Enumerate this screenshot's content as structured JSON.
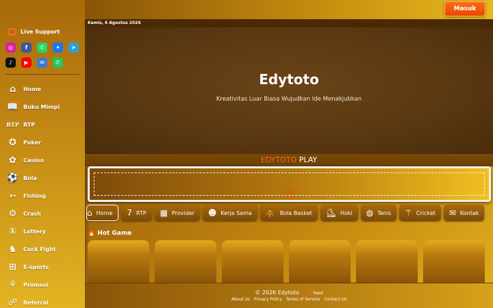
{
  "sidebar": {
    "live_support": "Live Support",
    "social_row1": [
      {
        "name": "instagram-icon",
        "glyph": "◎",
        "color": "#d6249f"
      },
      {
        "name": "facebook-icon",
        "glyph": "f",
        "color": "#3b5998"
      },
      {
        "name": "whatsapp-icon",
        "glyph": "✆",
        "color": "#25d366"
      },
      {
        "name": "messenger-icon",
        "glyph": "✦",
        "color": "#1877f2"
      },
      {
        "name": "telegram-icon",
        "glyph": "➤",
        "color": "#2aa1d8"
      }
    ],
    "social_row2": [
      {
        "name": "tiktok-icon",
        "glyph": "♪",
        "color": "#111111"
      },
      {
        "name": "youtube-icon",
        "glyph": "▶",
        "color": "#ff0000"
      },
      {
        "name": "email-icon",
        "glyph": "✉",
        "color": "#3a7bd5"
      },
      {
        "name": "phone-icon",
        "glyph": "✆",
        "color": "#22c55e"
      }
    ],
    "items": [
      {
        "label": "Home",
        "icon": "home-icon",
        "glyph": "⌂"
      },
      {
        "label": "Buku Mimpi",
        "icon": "book-icon",
        "glyph": "📖"
      },
      {
        "label": "RTP",
        "icon": "rtp-icon",
        "glyph": "RTP"
      },
      {
        "label": "Poker",
        "icon": "poker-chip-icon",
        "glyph": "✪"
      },
      {
        "label": "Casino",
        "icon": "casino-icon",
        "glyph": "✿"
      },
      {
        "label": "Bola",
        "icon": "soccer-shoe-icon",
        "glyph": "⚽"
      },
      {
        "label": "Fishing",
        "icon": "fish-icon",
        "glyph": "➳"
      },
      {
        "label": "Crash",
        "icon": "crash-icon",
        "glyph": "⚙"
      },
      {
        "label": "Lottery",
        "icon": "lottery-icon",
        "glyph": "①"
      },
      {
        "label": "Cock Fight",
        "icon": "rooster-icon",
        "glyph": "♞"
      },
      {
        "label": "E-sports",
        "icon": "gamepad-icon",
        "glyph": "⊞"
      },
      {
        "label": "Promosi",
        "icon": "promo-icon",
        "glyph": "⚘"
      },
      {
        "label": "Referral",
        "icon": "referral-icon",
        "glyph": "☍"
      }
    ]
  },
  "header": {
    "login_label": "Masuk",
    "date": "Kamis, 6 Agustus 2026"
  },
  "hero": {
    "title": "Edytoto",
    "subtitle": "Kreativitas Luar Biasa Wujudkan Ide Menakjubkan"
  },
  "play": {
    "brand": "EDYTOTO",
    "word": "PLAY",
    "currency": "IDR"
  },
  "tabs": [
    {
      "label": "Home",
      "icon": "home-icon",
      "glyph": "⌂",
      "active": true
    },
    {
      "label": "RTP",
      "icon": "seven-icon",
      "glyph": "7"
    },
    {
      "label": "Provider",
      "icon": "provider-icon",
      "glyph": "▦"
    },
    {
      "label": "Kerja Sama",
      "icon": "partner-icon",
      "glyph": "☻"
    },
    {
      "label": "Bola Basket",
      "icon": "basketball-icon",
      "glyph": "⛹"
    },
    {
      "label": "Hoki",
      "icon": "hockey-icon",
      "glyph": "⛸"
    },
    {
      "label": "Tenis",
      "icon": "tennis-icon",
      "glyph": "◍"
    },
    {
      "label": "Cricket",
      "icon": "cricket-icon",
      "glyph": "⚚"
    },
    {
      "label": "Kontak",
      "icon": "mail-icon",
      "glyph": "✉"
    }
  ],
  "hot_game": {
    "label": "Hot Game",
    "count": 6
  },
  "footer": {
    "copyright": "© 2026",
    "brand": "Edytoto",
    "feed": "Feed",
    "links": [
      "About Us",
      "Privacy Policy",
      "Terms of Service",
      "Contact Us"
    ]
  }
}
